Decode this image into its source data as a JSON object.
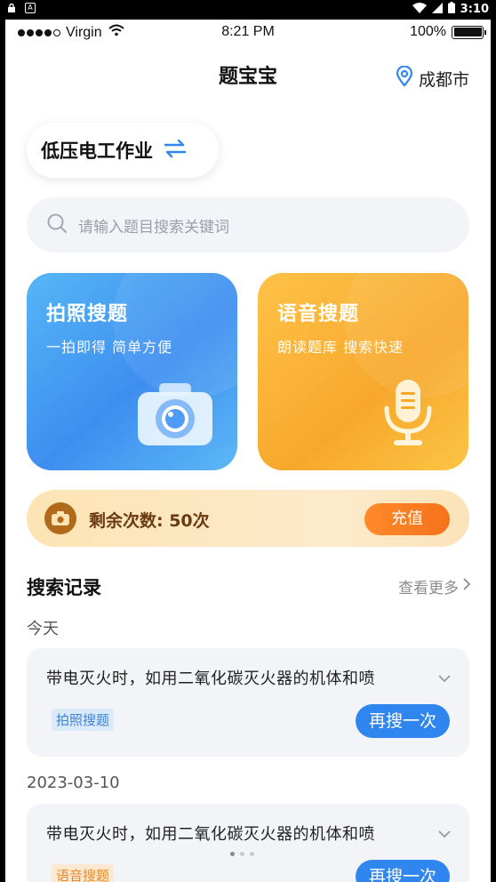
{
  "android_status": {
    "time": "3:10",
    "left_icons": [
      "lock-icon",
      "a-icon"
    ]
  },
  "ios_status": {
    "carrier": "Virgin",
    "time": "8:21 PM",
    "battery": "100%"
  },
  "header": {
    "title": "题宝宝",
    "location": "成都市"
  },
  "subject": {
    "label": "低压电工作业"
  },
  "search": {
    "placeholder": "请输入题目搜索关键词"
  },
  "cards": {
    "photo": {
      "title": "拍照搜题",
      "subtitle": "一拍即得 简单方便"
    },
    "voice": {
      "title": "语音搜题",
      "subtitle": "朗读题库 搜索快速"
    }
  },
  "remaining": {
    "text": "剩余次数: 50次",
    "button": "充值"
  },
  "history": {
    "title": "搜索记录",
    "more": "查看更多",
    "groups": [
      {
        "date": "今天",
        "question": "带电灭火时，如用二氧化碳灭火器的机体和喷",
        "tag": "拍照搜题",
        "button": "再搜一次"
      },
      {
        "date": "2023-03-10",
        "question": "带电灭火时，如用二氧化碳灭火器的机体和喷",
        "tag": "语音搜题",
        "button": "再搜一次"
      }
    ]
  },
  "colors": {
    "primary": "#2f86ee",
    "accent": "#f6721a",
    "photo_card": "#3e8ef0",
    "voice_card": "#f7a82c"
  }
}
